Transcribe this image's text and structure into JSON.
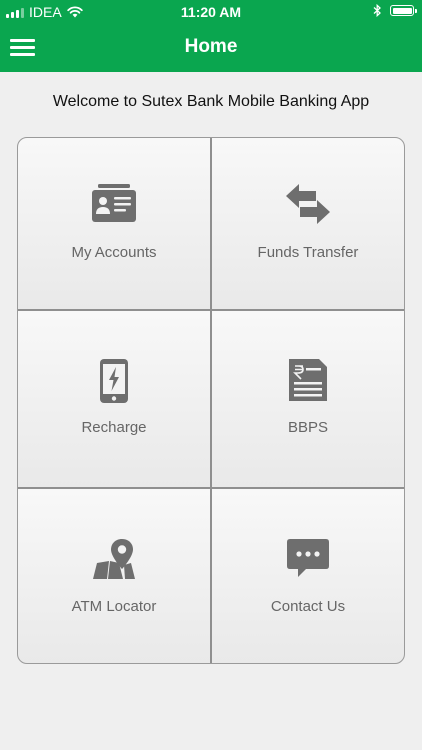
{
  "status_bar": {
    "carrier": "IDEA",
    "time": "11:20 AM"
  },
  "header": {
    "title": "Home"
  },
  "welcome_text": "Welcome to Sutex Bank Mobile Banking App",
  "tiles": [
    {
      "label": "My Accounts",
      "icon": "id-card-icon"
    },
    {
      "label": "Funds Transfer",
      "icon": "transfer-arrows-icon"
    },
    {
      "label": "Recharge",
      "icon": "mobile-recharge-icon"
    },
    {
      "label": "BBPS",
      "icon": "rupee-bill-icon"
    },
    {
      "label": "ATM Locator",
      "icon": "map-pin-icon"
    },
    {
      "label": "Contact Us",
      "icon": "chat-bubble-icon"
    }
  ],
  "colors": {
    "primary": "#0aa64f",
    "icon": "#6e6e6e",
    "label": "#666666",
    "background": "#efefef"
  }
}
